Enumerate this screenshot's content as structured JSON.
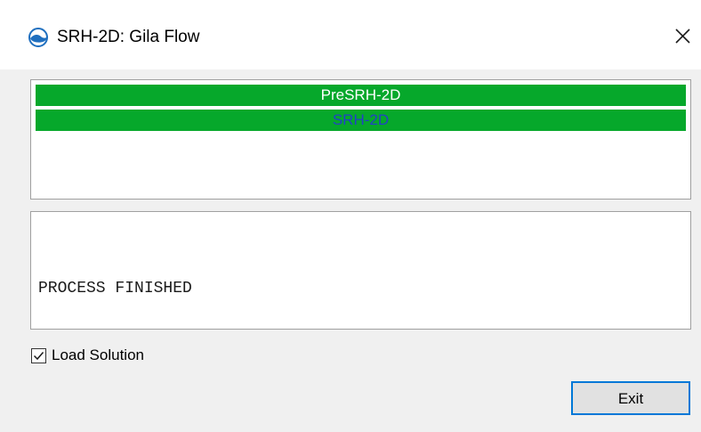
{
  "window": {
    "title": "SRH-2D: Gila Flow",
    "icon": "hydraulic-model-icon",
    "close_icon": "close-icon"
  },
  "process_list": {
    "items": [
      {
        "label": "PreSRH-2D",
        "status_color": "#06a82b",
        "text_color": "#ffffff"
      },
      {
        "label": "SRH-2D",
        "status_color": "#06a82b",
        "text_color": "#2440c8"
      }
    ]
  },
  "output": {
    "text": "PROCESS FINISHED"
  },
  "load_solution": {
    "label": "Load Solution",
    "checked": true
  },
  "buttons": {
    "exit_label": "Exit"
  },
  "colors": {
    "accent": "#0078d7",
    "success": "#06a82b"
  }
}
